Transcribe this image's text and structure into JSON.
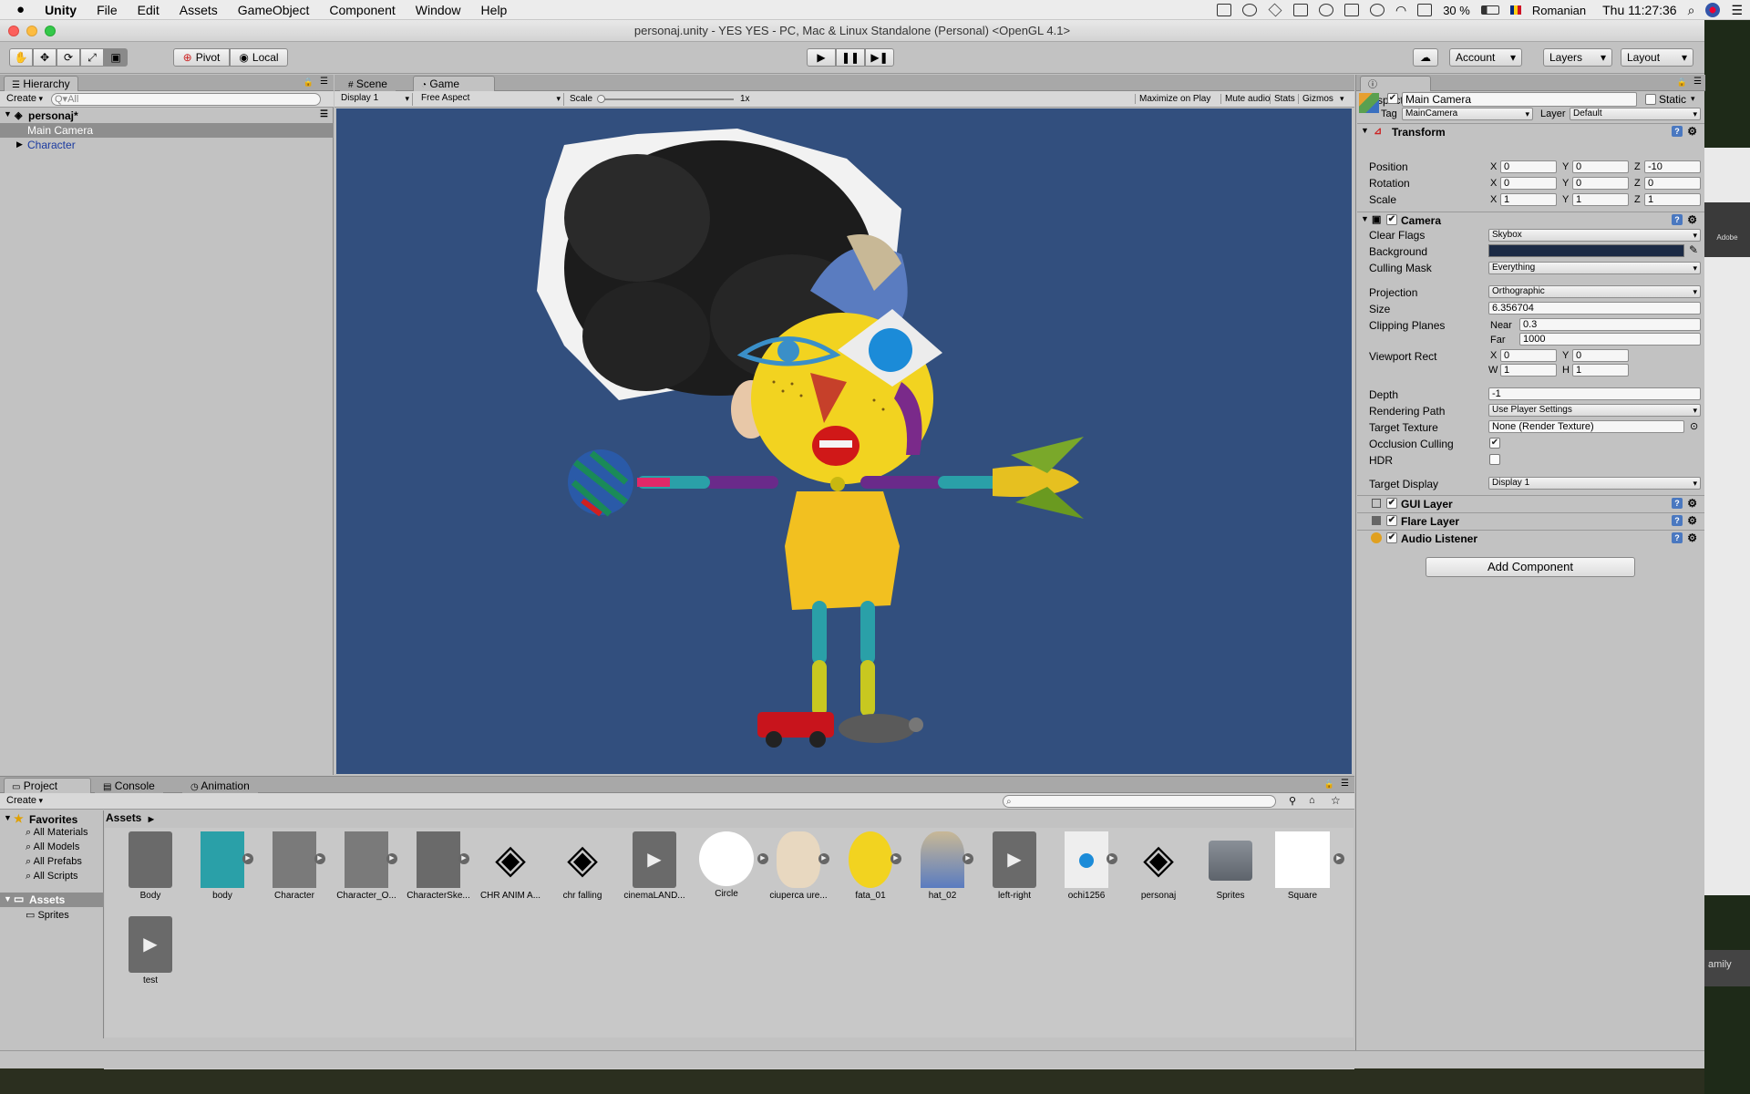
{
  "os_menubar": {
    "apple": "",
    "items": [
      "Unity",
      "File",
      "Edit",
      "Assets",
      "GameObject",
      "Component",
      "Window",
      "Help"
    ],
    "battery": "30 %",
    "input_language": "Romanian",
    "clock": "Thu 11:27:36"
  },
  "window": {
    "title": "personaj.unity - YES YES - PC, Mac & Linux Standalone (Personal) <OpenGL 4.1>"
  },
  "toolbar": {
    "pivot_label": "Pivot",
    "local_label": "Local",
    "account_label": "Account",
    "layers_label": "Layers",
    "layout_label": "Layout"
  },
  "hierarchy": {
    "tab_label": "Hierarchy",
    "create_label": "Create",
    "search_placeholder": "Q▾All",
    "scene_name": "personaj*",
    "items": [
      {
        "label": "Main Camera",
        "selected": true
      },
      {
        "label": "Character",
        "selected": false
      }
    ]
  },
  "game_view": {
    "tabs": [
      "Scene",
      "Game"
    ],
    "display": "Display 1",
    "aspect": "Free Aspect",
    "scale_label": "Scale",
    "scale_value": "1x",
    "options": [
      "Maximize on Play",
      "Mute audio",
      "Stats",
      "Gizmos"
    ],
    "background_color": "#324f7e"
  },
  "inspector": {
    "tab_label": "Inspector",
    "object_name": "Main Camera",
    "static_label": "Static",
    "tag_label": "Tag",
    "tag_value": "MainCamera",
    "layer_label": "Layer",
    "layer_value": "Default",
    "transform": {
      "title": "Transform",
      "position": {
        "label": "Position",
        "x": "0",
        "y": "0",
        "z": "-10"
      },
      "rotation": {
        "label": "Rotation",
        "x": "0",
        "y": "0",
        "z": "0"
      },
      "scale": {
        "label": "Scale",
        "x": "1",
        "y": "1",
        "z": "1"
      }
    },
    "camera": {
      "title": "Camera",
      "clear_flags_label": "Clear Flags",
      "clear_flags": "Skybox",
      "background_label": "Background",
      "background_color": "#1b2a45",
      "culling_mask_label": "Culling Mask",
      "culling_mask": "Everything",
      "projection_label": "Projection",
      "projection": "Orthographic",
      "size_label": "Size",
      "size": "6.356704",
      "clipping_label": "Clipping Planes",
      "near_label": "Near",
      "near": "0.3",
      "far_label": "Far",
      "far": "1000",
      "viewport_label": "Viewport Rect",
      "vp_x": "0",
      "vp_y": "0",
      "vp_w": "1",
      "vp_h": "1",
      "depth_label": "Depth",
      "depth": "-1",
      "rendering_path_label": "Rendering Path",
      "rendering_path": "Use Player Settings",
      "target_texture_label": "Target Texture",
      "target_texture": "None (Render Texture)",
      "occlusion_label": "Occlusion Culling",
      "hdr_label": "HDR",
      "target_display_label": "Target Display",
      "target_display": "Display 1"
    },
    "components": [
      "GUI Layer",
      "Flare Layer",
      "Audio Listener"
    ],
    "add_component_label": "Add Component"
  },
  "project": {
    "tabs": [
      "Project",
      "Console",
      "Animation"
    ],
    "create_label": "Create",
    "favorites_label": "Favorites",
    "favorites": [
      "All Materials",
      "All Models",
      "All Prefabs",
      "All Scripts"
    ],
    "assets_label": "Assets",
    "sprites_label": "Sprites",
    "breadcrumb": "Assets",
    "assets": [
      "Body",
      "body",
      "Character",
      "Character_O...",
      "CharacterSke...",
      "CHR ANIM A...",
      "chr falling",
      "cinemaLAND...",
      "Circle",
      "ciuperca ure...",
      "fata_01",
      "hat_02",
      "left-right",
      "ochi1256",
      "personaj",
      "Sprites",
      "Square",
      "test"
    ]
  },
  "background_app": {
    "label": "Adobe",
    "snippet": "amily"
  }
}
